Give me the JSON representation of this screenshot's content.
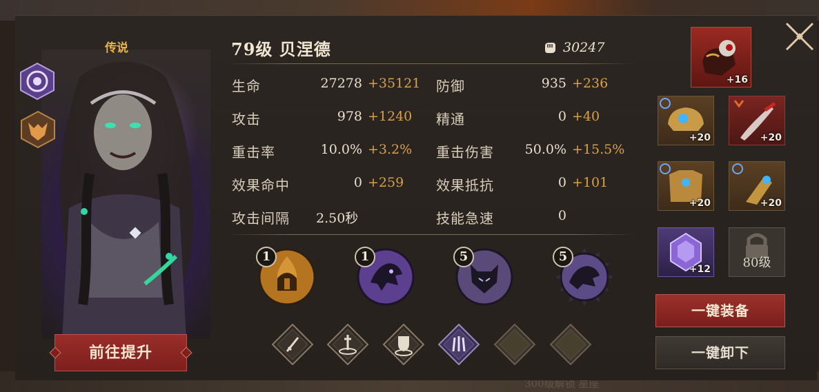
{
  "hero": {
    "rarity": "传说",
    "title": "79级  贝涅德",
    "power": "30247"
  },
  "stats": [
    {
      "label": "生命",
      "base": "27278",
      "bonus": "+35121"
    },
    {
      "label": "防御",
      "base": "935",
      "bonus": "+236"
    },
    {
      "label": "攻击",
      "base": "978",
      "bonus": "+1240"
    },
    {
      "label": "精通",
      "base": "0",
      "bonus": "+40"
    },
    {
      "label": "重击率",
      "base": "10.0%",
      "bonus": "+3.2%"
    },
    {
      "label": "重击伤害",
      "base": "50.0%",
      "bonus": "+15.5%"
    },
    {
      "label": "效果命中",
      "base": "0",
      "bonus": "+259"
    },
    {
      "label": "效果抵抗",
      "base": "0",
      "bonus": "+101"
    },
    {
      "label": "攻击间隔",
      "base": "2.50秒",
      "bonus": ""
    },
    {
      "label": "技能急速",
      "base": "0",
      "bonus": ""
    }
  ],
  "skills": [
    {
      "level": "1",
      "icon": "flame-helmet-icon",
      "color": "#b5741f"
    },
    {
      "level": "1",
      "icon": "purple-beast-icon",
      "color": "#5c3f8e"
    },
    {
      "level": "5",
      "icon": "wolf-head-icon",
      "color": "#5a4a7a"
    },
    {
      "level": "5",
      "icon": "wolf-roar-icon",
      "color": "#5c4b86"
    }
  ],
  "runes": [
    {
      "icon": "sword-icon",
      "active": true
    },
    {
      "icon": "dagger-icon",
      "active": true
    },
    {
      "icon": "shield-icon",
      "active": true
    },
    {
      "icon": "claw-icon",
      "active": true
    },
    {
      "icon": "empty-slot-icon",
      "active": false
    },
    {
      "icon": "empty-slot-icon",
      "active": false
    }
  ],
  "equipment": {
    "main": {
      "level": "+16",
      "icon": "demon-skull-gauntlet-icon"
    },
    "slots": [
      {
        "level": "+20",
        "icon": "golden-helmet-icon"
      },
      {
        "level": "+20",
        "icon": "red-dagger-icon"
      },
      {
        "level": "+20",
        "icon": "golden-armor-icon"
      },
      {
        "level": "+20",
        "icon": "golden-gauntlet-icon"
      },
      {
        "level": "+12",
        "icon": "purple-gem-icon"
      }
    ],
    "locked_slot": "80级"
  },
  "buttons": {
    "promote": "前往提升",
    "equip_all": "一键装备",
    "unequip_all": "一键卸下"
  },
  "background_text": "300级解锁    星座"
}
